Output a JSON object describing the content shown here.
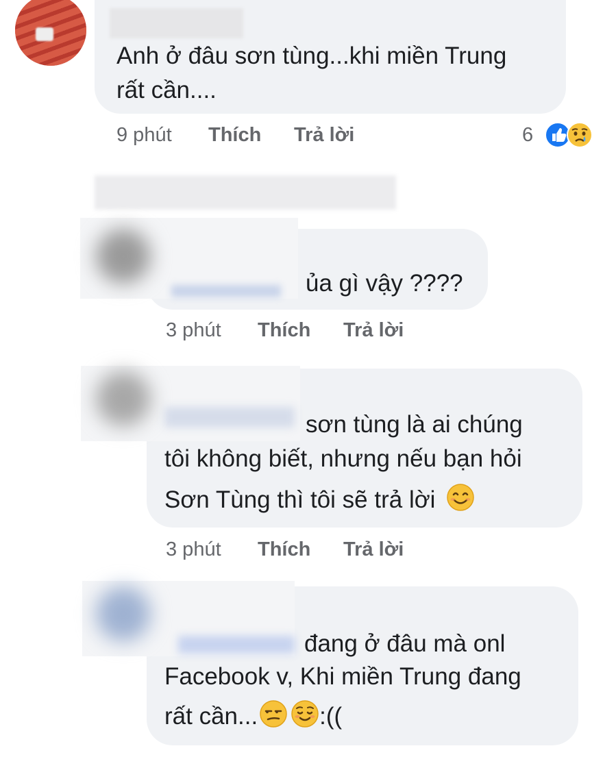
{
  "comments": [
    {
      "text_lines": [
        "Anh ở đâu sơn tùng...khi miền Trung",
        "rất cần...."
      ],
      "time": "9 phút",
      "like_label": "Thích",
      "reply_label": "Trả lời",
      "reaction_count": "6",
      "reactions": [
        "like-icon",
        "sad-icon"
      ]
    },
    {
      "text_lines": [
        "ủa gì vậy ????"
      ],
      "time": "3 phút",
      "like_label": "Thích",
      "reply_label": "Trả lời"
    },
    {
      "text_lines": [
        "sơn tùng là ai chúng",
        "tôi không biết, nhưng nếu bạn hỏi",
        "Sơn Tùng thì tôi sẽ trả lời"
      ],
      "emojis": [
        "smiling-face-icon"
      ],
      "time": "3 phút",
      "like_label": "Thích",
      "reply_label": "Trả lời"
    },
    {
      "text_lines": [
        "đang ở đâu mà onl",
        "Facebook v, Khi miền Trung đang",
        "rất cần..."
      ],
      "emojis": [
        "unamused-face-icon",
        "relieved-face-icon"
      ],
      "tail_text": ":((",
      "time": "",
      "like_label": "",
      "reply_label": ""
    }
  ],
  "colors": {
    "bubble": "#f0f2f5",
    "meta_text": "#65676b",
    "like_blue": "#1877f2",
    "emoji_yellow": "#f7c23a"
  }
}
